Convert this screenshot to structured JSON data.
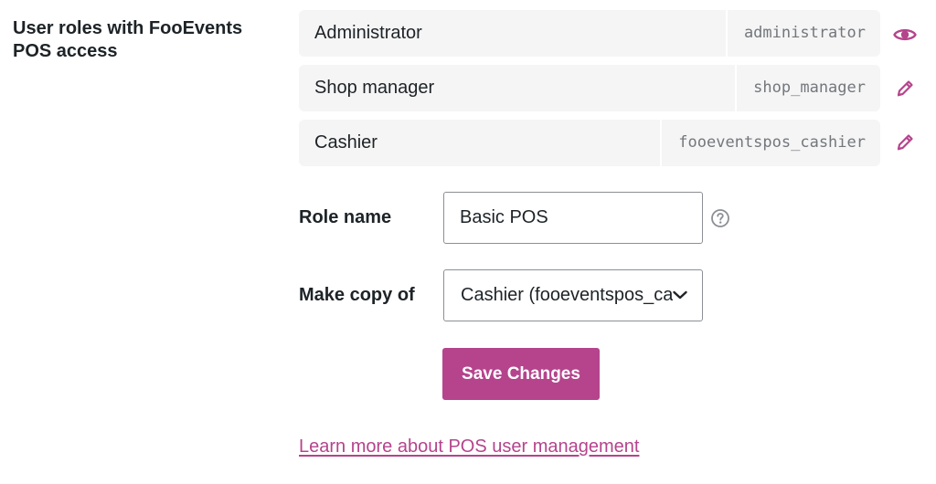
{
  "section": {
    "label": "User roles with FooEvents POS access"
  },
  "roles": [
    {
      "name": "Administrator",
      "slug": "administrator",
      "action_icon": "eye-icon"
    },
    {
      "name": "Shop manager",
      "slug": "shop_manager",
      "action_icon": "pencil-icon"
    },
    {
      "name": "Cashier",
      "slug": "fooeventspos_cashier",
      "action_icon": "pencil-icon"
    }
  ],
  "form": {
    "role_name_label": "Role name",
    "role_name_value": "Basic POS",
    "make_copy_label": "Make copy of",
    "make_copy_selected": "Cashier (fooeventspos_cashier)",
    "help_icon": "question-circle-icon",
    "save_label": "Save Changes"
  },
  "link": {
    "text": "Learn more about POS user management"
  },
  "colors": {
    "accent": "#b5448c",
    "row_background": "#f5f5f5",
    "slug_text": "#73777c",
    "input_border": "#8c8f94"
  }
}
